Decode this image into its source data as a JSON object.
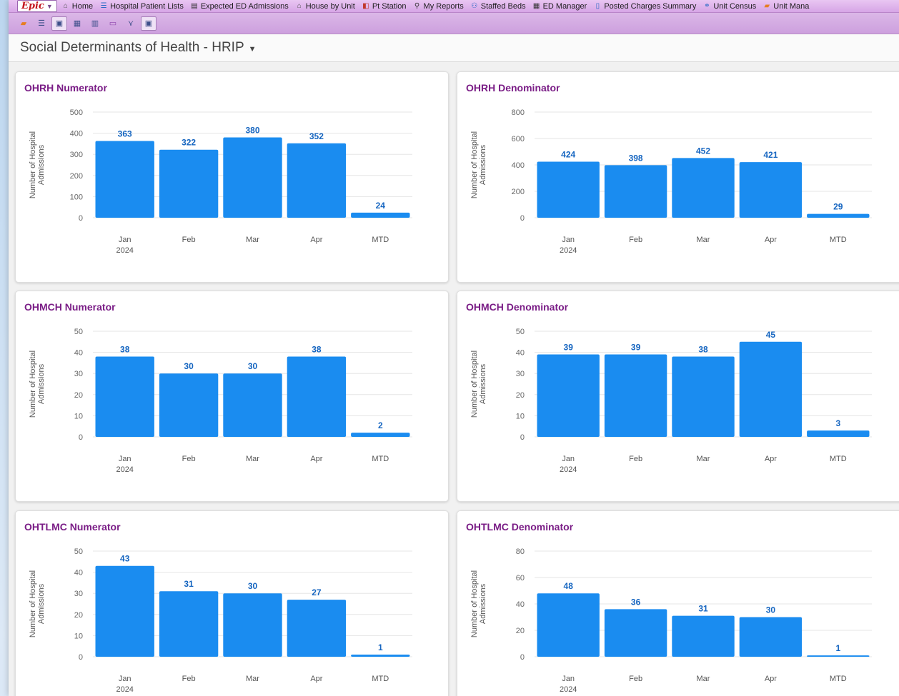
{
  "menubar": {
    "epic_label": "Epic",
    "items": [
      {
        "label": "Home",
        "icon": "home-icon"
      },
      {
        "label": "Hospital Patient Lists",
        "icon": "patient-list-icon"
      },
      {
        "label": "Expected ED Admissions",
        "icon": "ed-admissions-icon"
      },
      {
        "label": "House by Unit",
        "icon": "house-icon"
      },
      {
        "label": "Pt Station",
        "icon": "pt-station-icon"
      },
      {
        "label": "My Reports",
        "icon": "search-icon"
      },
      {
        "label": "Staffed Beds",
        "icon": "staffed-beds-icon"
      },
      {
        "label": "ED Manager",
        "icon": "ed-manager-icon"
      },
      {
        "label": "Posted Charges Summary",
        "icon": "charges-icon"
      },
      {
        "label": "Unit Census",
        "icon": "unit-census-icon"
      },
      {
        "label": "Unit Mana",
        "icon": "unit-manager-icon"
      }
    ]
  },
  "toolbar": {
    "buttons": [
      {
        "icon": "dashboard-icon"
      },
      {
        "icon": "list-icon"
      },
      {
        "icon": "report-icon"
      },
      {
        "icon": "calendar-icon"
      },
      {
        "icon": "grid-icon"
      },
      {
        "icon": "inbox-icon"
      },
      {
        "icon": "chart-icon"
      },
      {
        "icon": "window-icon"
      }
    ]
  },
  "page": {
    "title": "Social Determinants of Health - HRIP"
  },
  "chart_data": [
    {
      "type": "bar",
      "title": "OHRH Numerator",
      "ylabel": "Number of Hospital Admissions",
      "categories": [
        "Jan",
        "Feb",
        "Mar",
        "Apr",
        "MTD"
      ],
      "year_label": "2024",
      "values": [
        363,
        322,
        380,
        352,
        24
      ],
      "ylim": [
        0,
        500
      ],
      "yticks": [
        0,
        100,
        200,
        300,
        400,
        500
      ],
      "bar_color": "#1a8cf0"
    },
    {
      "type": "bar",
      "title": "OHRH Denominator",
      "ylabel": "Number of Hospital Admissions",
      "categories": [
        "Jan",
        "Feb",
        "Mar",
        "Apr",
        "MTD"
      ],
      "year_label": "2024",
      "values": [
        424,
        398,
        452,
        421,
        29
      ],
      "ylim": [
        0,
        800
      ],
      "yticks": [
        0,
        200,
        400,
        600,
        800
      ],
      "bar_color": "#1a8cf0"
    },
    {
      "type": "bar",
      "title": "OHMCH Numerator",
      "ylabel": "Number of Hospital Admissions",
      "categories": [
        "Jan",
        "Feb",
        "Mar",
        "Apr",
        "MTD"
      ],
      "year_label": "2024",
      "values": [
        38,
        30,
        30,
        38,
        2
      ],
      "ylim": [
        0,
        50
      ],
      "yticks": [
        0,
        10,
        20,
        30,
        40,
        50
      ],
      "bar_color": "#1a8cf0"
    },
    {
      "type": "bar",
      "title": "OHMCH Denominator",
      "ylabel": "Number of Hospital Admissions",
      "categories": [
        "Jan",
        "Feb",
        "Mar",
        "Apr",
        "MTD"
      ],
      "year_label": "2024",
      "values": [
        39,
        39,
        38,
        45,
        3
      ],
      "ylim": [
        0,
        50
      ],
      "yticks": [
        0,
        10,
        20,
        30,
        40,
        50
      ],
      "bar_color": "#1a8cf0"
    },
    {
      "type": "bar",
      "title": "OHTLMC Numerator",
      "ylabel": "Number of Hospital Admissions",
      "categories": [
        "Jan",
        "Feb",
        "Mar",
        "Apr",
        "MTD"
      ],
      "year_label": "2024",
      "values": [
        43,
        31,
        30,
        27,
        1
      ],
      "ylim": [
        0,
        50
      ],
      "yticks": [
        0,
        10,
        20,
        30,
        40,
        50
      ],
      "bar_color": "#1a8cf0"
    },
    {
      "type": "bar",
      "title": "OHTLMC Denominator",
      "ylabel": "Number of Hospital Admissions",
      "categories": [
        "Jan",
        "Feb",
        "Mar",
        "Apr",
        "MTD"
      ],
      "year_label": "2024",
      "values": [
        48,
        36,
        31,
        30,
        1
      ],
      "ylim": [
        0,
        80
      ],
      "yticks": [
        0,
        20,
        40,
        60,
        80
      ],
      "bar_color": "#1a8cf0"
    }
  ]
}
